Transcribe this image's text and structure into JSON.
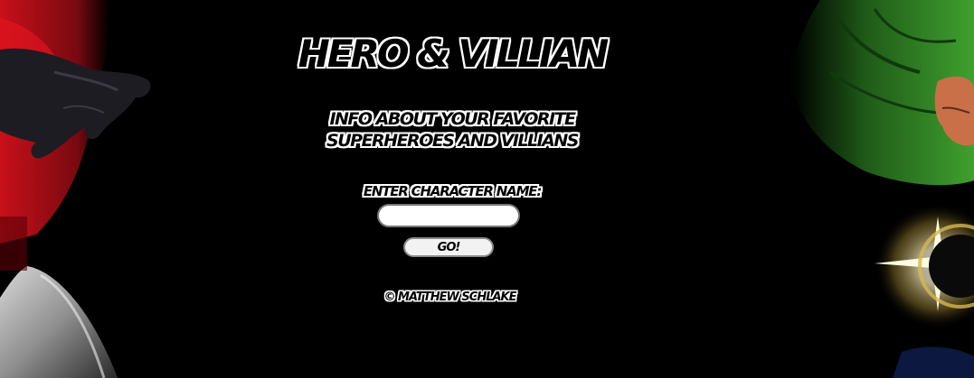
{
  "header": {
    "title": "Hero & Villian",
    "subtitle_line1": "Info about your favorite",
    "subtitle_line2": "superheroes and villians"
  },
  "search": {
    "label": "Enter Character Name:",
    "value": "",
    "placeholder": "",
    "button_label": "Go!"
  },
  "footer": {
    "copyright": "© Matthew Schlake"
  },
  "colors": {
    "background": "#000000",
    "text_fill": "#000000",
    "text_outline": "#ffffff",
    "hero_red": "#c8101a",
    "villain_green": "#2e8a22"
  },
  "artwork": {
    "left": "hero-artwork-red",
    "right": "villain-artwork-green"
  }
}
